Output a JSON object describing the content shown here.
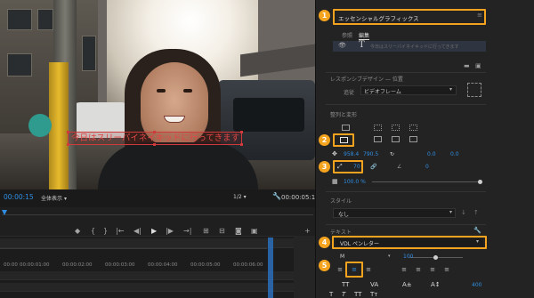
{
  "video": {
    "caption": "今日はスリーパイネイキッドに行ってきます"
  },
  "player": {
    "timecode_current": "00:00:15",
    "fit": "全体表示",
    "fraction": "1/2",
    "timecode_total": "00:00:05:14"
  },
  "timeline": {
    "ticks": [
      "00:00",
      "00:00:01:00",
      "00:00:02:00",
      "00:00:03:00",
      "00:00:04:00",
      "00:00:05:00",
      "00:00:06:00"
    ]
  },
  "panel": {
    "title": "エッセンシャルグラフィックス",
    "tabs": [
      "参照",
      "編集"
    ],
    "text_placeholder": "今日はスリーパイネイキッドに行ってきます",
    "responsive_label": "レスポンシブデザイン — 位置",
    "pin_label": "追従",
    "pin_value": "ビデオフレーム",
    "align_label": "整列と変形",
    "pos_x": "958.4",
    "pos_y": "790.5",
    "anchor_x": "0.0",
    "anchor_y": "0.0",
    "scale": "70",
    "rotation": "0",
    "opacity": "100.0 %",
    "style_label": "スタイル",
    "style_value": "なし",
    "text_label": "テキスト",
    "font_value": "VDL ペンレター",
    "font_style": "M",
    "font_size": "100",
    "tracking": "400",
    "badges": [
      "1",
      "2",
      "3",
      "4",
      "5"
    ],
    "accent": "#f4a31e",
    "blue": "#2f8ee3"
  }
}
